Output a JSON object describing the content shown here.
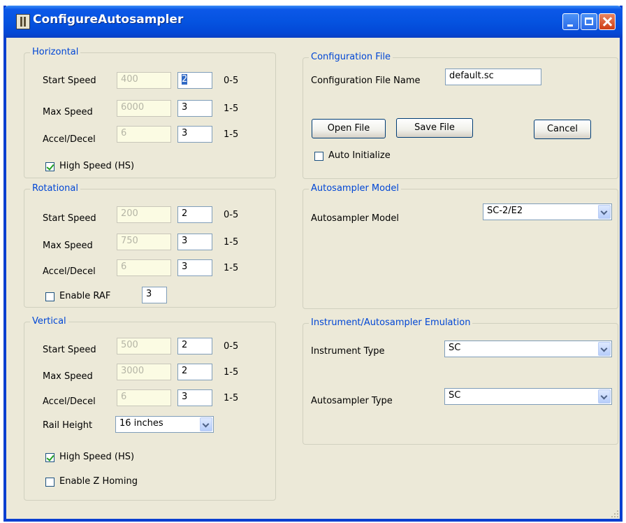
{
  "window": {
    "title": "ConfigureAutosampler"
  },
  "horizontal": {
    "legend": "Horizontal",
    "rows": [
      {
        "label": "Start Speed",
        "current": "400",
        "value": "2",
        "range": "0-5"
      },
      {
        "label": "Max Speed",
        "current": "6000",
        "value": "3",
        "range": "1-5"
      },
      {
        "label": "Accel/Decel",
        "current": "6",
        "value": "3",
        "range": "1-5"
      }
    ],
    "high_speed": {
      "label": "High Speed (HS)",
      "checked": true
    }
  },
  "rotational": {
    "legend": "Rotational",
    "rows": [
      {
        "label": "Start Speed",
        "current": "200",
        "value": "2",
        "range": "0-5"
      },
      {
        "label": "Max Speed",
        "current": "750",
        "value": "3",
        "range": "1-5"
      },
      {
        "label": "Accel/Decel",
        "current": "6",
        "value": "3",
        "range": "1-5"
      }
    ],
    "enable_raf": {
      "label": "Enable RAF",
      "checked": false,
      "value": "3"
    }
  },
  "vertical": {
    "legend": "Vertical",
    "rows": [
      {
        "label": "Start Speed",
        "current": "500",
        "value": "2",
        "range": "0-5"
      },
      {
        "label": "Max Speed",
        "current": "3000",
        "value": "2",
        "range": "1-5"
      },
      {
        "label": "Accel/Decel",
        "current": "6",
        "value": "3",
        "range": "1-5"
      }
    ],
    "rail_height": {
      "label": "Rail Height",
      "value": "16 inches"
    },
    "high_speed": {
      "label": "High Speed (HS)",
      "checked": true
    },
    "z_homing": {
      "label": "Enable Z Homing",
      "checked": false
    }
  },
  "config_file": {
    "legend": "Configuration File",
    "name_label": "Configuration File Name",
    "name_value": "default.sc",
    "open_label": "Open File",
    "save_label": "Save File",
    "cancel_label": "Cancel",
    "auto_init": {
      "label": "Auto Initialize",
      "checked": false
    }
  },
  "model": {
    "legend": "Autosampler Model",
    "label": "Autosampler Model",
    "value": "SC-2/E2"
  },
  "emulation": {
    "legend": "Instrument/Autosampler Emulation",
    "instrument_label": "Instrument Type",
    "instrument_value": "SC",
    "autosampler_label": "Autosampler Type",
    "autosampler_value": "SC"
  }
}
